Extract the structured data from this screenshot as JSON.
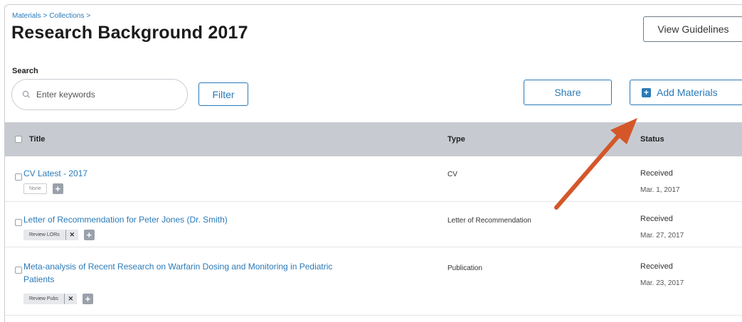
{
  "breadcrumb": {
    "item1": "Materials",
    "item2": "Collections",
    "sep": ">"
  },
  "page": {
    "title": "Research Background 2017"
  },
  "header": {
    "guidelines_label": "View Guidelines"
  },
  "search": {
    "label": "Search",
    "placeholder": "Enter keywords",
    "value": ""
  },
  "toolbar": {
    "filter_label": "Filter",
    "share_label": "Share",
    "add_label": "Add Materials",
    "add_icon": "plus-square-icon"
  },
  "table": {
    "columns": [
      "Title",
      "Type",
      "Status"
    ],
    "rows": [
      {
        "title": "CV Latest - 2017",
        "type": "CV",
        "status": "Received",
        "date": "Mar. 1, 2017",
        "tag": "None"
      },
      {
        "title": "Letter of Recommendation for Peter Jones (Dr. Smith)",
        "type": "Letter of Recommendation",
        "status": "Received",
        "date": "Mar. 27, 2017",
        "tag": "Review LORs"
      },
      {
        "title_line1": "Meta-analysis of Recent Research on Warfarin Dosing and Monitoring in Pediatric",
        "title_line2": "Patients",
        "type": "Publication",
        "status": "Received",
        "date": "Mar. 23, 2017",
        "tag": "Review Pubs"
      }
    ]
  },
  "annotation": {
    "arrow_color": "#d4572a",
    "points_to": "add-materials-button"
  },
  "colors": {
    "link": "#2a7ab8",
    "header_bg": "#c7cbd1"
  }
}
